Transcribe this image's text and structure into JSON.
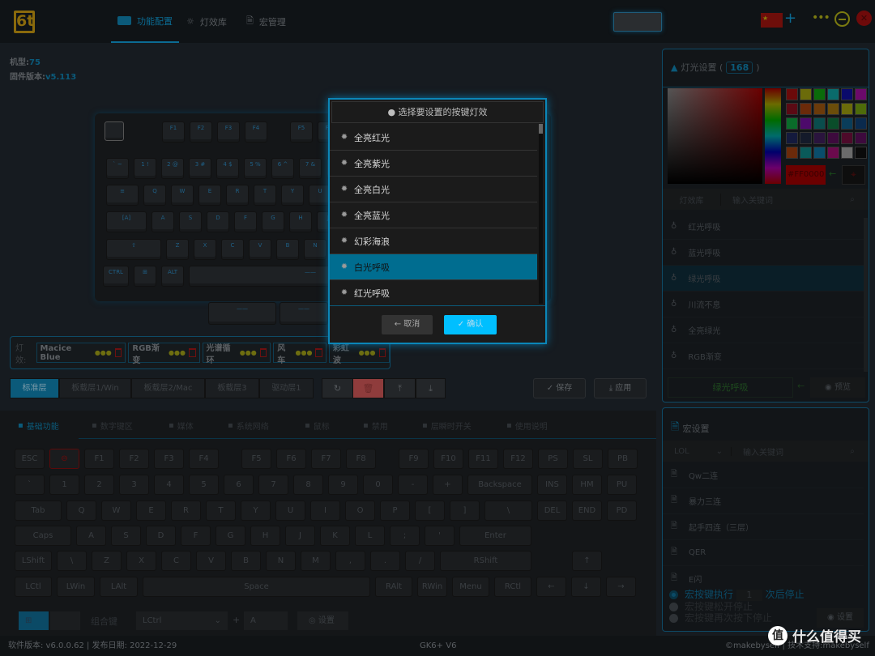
{
  "header": {
    "logo": "6t",
    "tabs": [
      {
        "label": "功能配置",
        "icon": "keyboard-icon"
      },
      {
        "label": "灯效库",
        "icon": "bulb-icon"
      },
      {
        "label": "宏管理",
        "icon": "document-icon"
      }
    ],
    "active_tab": 0,
    "plus": "+",
    "more": "•••",
    "close": "✕"
  },
  "device": {
    "model_label": "机型:",
    "model": "75",
    "firmware_label": "固件版本:",
    "firmware": "v5.113"
  },
  "preview_keyboard": {
    "rows": [
      [
        "F1",
        "F2",
        "F3",
        "F4",
        "F5",
        "F6",
        "F7",
        "F8"
      ],
      [
        "` ~",
        "1 !",
        "2 @",
        "3 #",
        "4 $",
        "5 %",
        "6 ^",
        "7 &",
        "8 *",
        "9 (",
        "0 )"
      ],
      [
        "≡",
        "Q",
        "W",
        "E",
        "R",
        "T",
        "Y",
        "U",
        "I",
        "O"
      ],
      [
        "[A]",
        "A",
        "S",
        "D",
        "F",
        "G",
        "H",
        "J",
        "K"
      ],
      [
        "⇧",
        "Z",
        "X",
        "C",
        "V",
        "B",
        "N",
        "M"
      ],
      [
        "CTRL",
        "⊞",
        "ALT",
        "——"
      ]
    ],
    "bottom_keys": [
      "——",
      "——"
    ]
  },
  "effects": {
    "label": "灯效:",
    "items": [
      "Macice Blue",
      "RGB渐变",
      "光谱循环",
      "风车",
      "彩虹波"
    ]
  },
  "layers": {
    "items": [
      "标准层",
      "板载层1/Win",
      "板载层2/Mac",
      "板载层3",
      "驱动层1"
    ],
    "active": 0,
    "actions": [
      "↻",
      "🗑",
      "⤒",
      "⤓"
    ],
    "save": "✓ 保存",
    "apply": "⤓ 应用"
  },
  "lower": {
    "tabs": [
      "基础功能",
      "数字键区",
      "媒体",
      "系统网络",
      "鼠标",
      "禁用",
      "层瞬时开关",
      "使用说明"
    ],
    "active_tab": 0,
    "keys": [
      [
        "ESC",
        "⊖",
        "F1",
        "F2",
        "F3",
        "F4",
        "F5",
        "F6",
        "F7",
        "F8",
        "F9",
        "F10",
        "F11",
        "F12",
        "PS",
        "SL",
        "PB"
      ],
      [
        "`",
        "1",
        "2",
        "3",
        "4",
        "5",
        "6",
        "7",
        "8",
        "9",
        "0",
        "-",
        "+",
        "Backspace",
        "INS",
        "HM",
        "PU"
      ],
      [
        "Tab",
        "Q",
        "W",
        "E",
        "R",
        "T",
        "Y",
        "U",
        "I",
        "O",
        "P",
        "[",
        "]",
        "\\",
        "DEL",
        "END",
        "PD"
      ],
      [
        "Caps",
        "A",
        "S",
        "D",
        "F",
        "G",
        "H",
        "J",
        "K",
        "L",
        ";",
        "'",
        "Enter"
      ],
      [
        "LShift",
        "\\",
        "Z",
        "X",
        "C",
        "V",
        "B",
        "N",
        "M",
        ",",
        ".",
        "/",
        "RShift",
        "↑"
      ],
      [
        "LCtl",
        "LWin",
        "LAlt",
        "Space",
        "RAlt",
        "RWin",
        "Menu",
        "RCtl",
        "←",
        "↓",
        "→"
      ]
    ],
    "combo_label": "组合键",
    "combo_modifier": "LCtrl",
    "combo_plus": "+",
    "combo_key": "A",
    "set_button": "设置"
  },
  "footer": {
    "version": "软件版本: v6.0.0.62 | 发布日期: 2022-12-29",
    "device": "GK6+ V6",
    "credit": "©makebyself | 技术支持:makebyself",
    "watermark": "值 什么值得买"
  },
  "light_panel": {
    "title": "灯光设置 (",
    "count": "168",
    "title_end": ")",
    "hex": "#FF0000",
    "swatches": [
      "#6b0a0a",
      "#6b6b0a",
      "#0a6b0a",
      "#0a6b6b",
      "#0a0a6b",
      "#6b0a6b",
      "#5a0a14",
      "#6b2a0a",
      "#6b3a0a",
      "#6b4d0a",
      "#6b6b0a",
      "#4d6b0a",
      "#0a6b2a",
      "#4d0a6b",
      "#0a4d4d",
      "#0a4d2a",
      "#0a3d5a",
      "#0a2a4d",
      "#141a3d",
      "#141a2a",
      "#2a143d",
      "#3d0a3d",
      "#4d0a2a",
      "#3d0a3d",
      "#6b2a0a",
      "#0a5a5a",
      "#0a4d6b",
      "#6b0a4d",
      "#6b6b6b",
      "#0a0a0a"
    ],
    "library_label": "灯效库",
    "search_placeholder": "输入关键词",
    "items": [
      "红光呼吸",
      "蓝光呼吸",
      "绿光呼吸",
      "川流不息",
      "全亮绿光",
      "RGB渐变"
    ],
    "selected": 2,
    "current": "绿光呼吸",
    "preview": "预览"
  },
  "macro_panel": {
    "title": "宏设置",
    "game": "LOL",
    "search_placeholder": "输入关键词",
    "items": [
      "Qw二连",
      "暴力三连",
      "起手四连（三层）",
      "QER",
      "E闪"
    ],
    "options": [
      {
        "pre": "宏按键执行",
        "value": "1",
        "post": "次后停止"
      },
      {
        "pre": "宏按键松开停止"
      },
      {
        "pre": "宏按键再次按下停止"
      }
    ],
    "selected_option": 0,
    "set_button": "设置"
  },
  "modal": {
    "title": "选择要设置的按键灯效",
    "items": [
      "全亮红光",
      "全亮紫光",
      "全亮白光",
      "全亮蓝光",
      "幻彩海浪",
      "白光呼吸",
      "红光呼吸"
    ],
    "selected": 5,
    "cancel": "← 取消",
    "confirm": "✓ 确认",
    "accent": "#00bfff"
  }
}
